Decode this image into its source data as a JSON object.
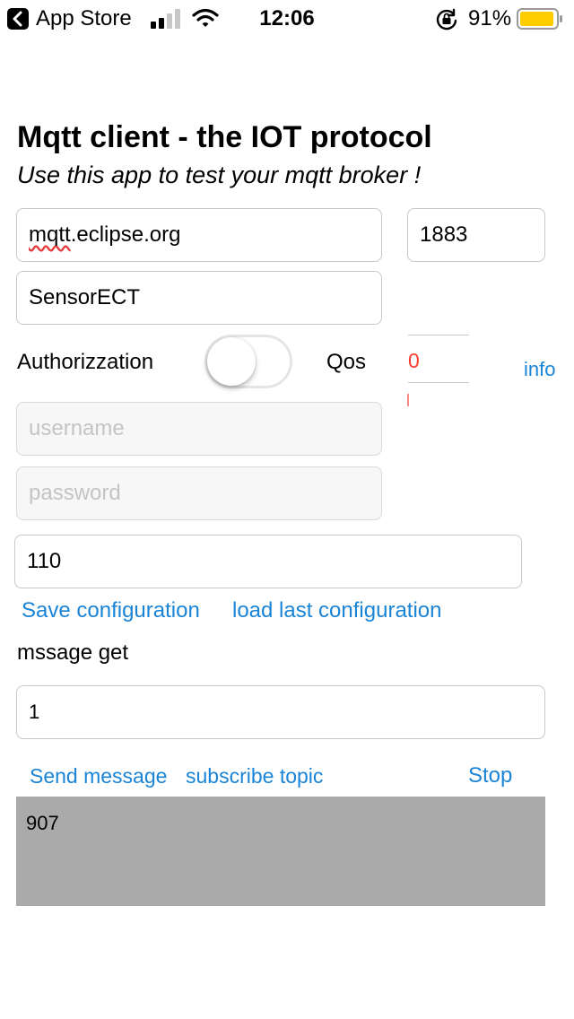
{
  "status_bar": {
    "back_app": "App Store",
    "time": "12:06",
    "battery": "91%"
  },
  "header": {
    "title": "Mqtt client - the IOT protocol",
    "subtitle": "Use this app to test your mqtt broker !"
  },
  "connection": {
    "host_prefix": "mqtt",
    "host_suffix": ".eclipse.org",
    "port": "1883",
    "client_id": "SensorECT"
  },
  "auth": {
    "label": "Authorizzation",
    "enabled": false,
    "username_placeholder": "username",
    "password_placeholder": "password"
  },
  "qos": {
    "label": "Qos",
    "value": "0",
    "info_label": "info"
  },
  "topic": {
    "value": "110"
  },
  "config_actions": {
    "save_label": "Save configuration",
    "load_label": "load last configuration"
  },
  "message": {
    "label": "mssage get",
    "value": "1"
  },
  "message_actions": {
    "send_label": "Send message",
    "subscribe_label": "subscribe topic",
    "stop_label": "Stop"
  },
  "output": {
    "text": "907"
  },
  "colors": {
    "link": "#1a84d6",
    "qos_value": "#ff3b30",
    "output_background": "#aaaaaa",
    "battery": "#ffcc00"
  }
}
